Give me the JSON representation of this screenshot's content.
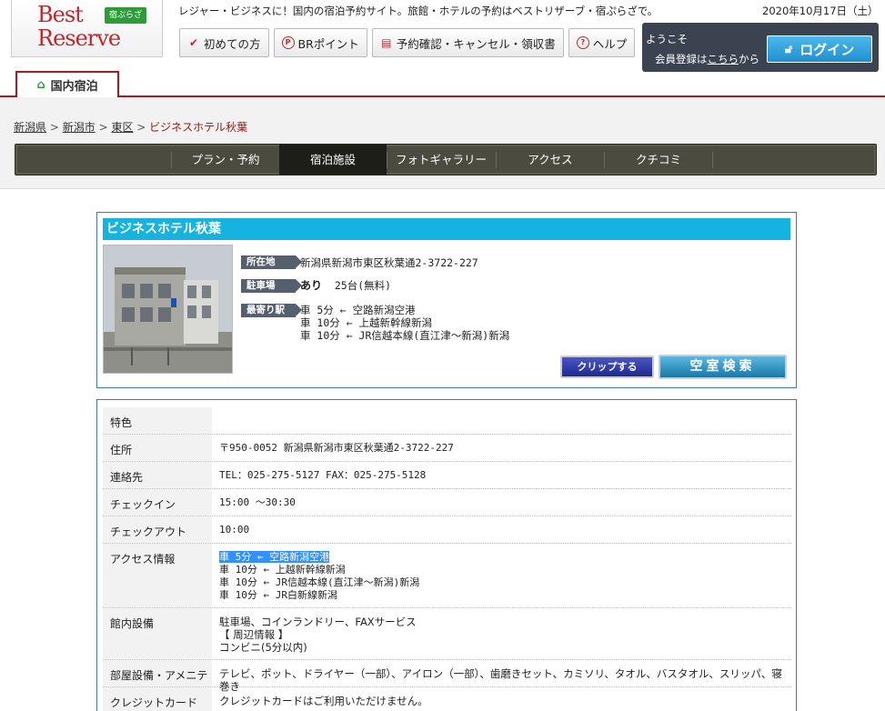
{
  "header": {
    "logo_best": "Best",
    "logo_reserve": "Reserve",
    "logo_badge": "宿ぷらざ",
    "tagline": "レジャー・ビジネスに！国内の宿泊予約サイト。旅館・ホテルの予約はベストリザーブ・宿ぷらざで。",
    "date": "2020年10月17日（土）",
    "nav": [
      {
        "label": "初めての方",
        "icon": "beginner-icon"
      },
      {
        "label": "BRポイント",
        "icon": "points-icon"
      },
      {
        "label": "予約確認・キャンセル・領収書",
        "icon": "document-icon"
      },
      {
        "label": "ヘルプ",
        "icon": "help-icon"
      }
    ],
    "welcome": "ようこそ",
    "register_prefix": "会員登録は",
    "register_link": "こちら",
    "register_suffix": "から",
    "login_label": "ログイン"
  },
  "tab": {
    "label": "国内宿泊"
  },
  "breadcrumb": [
    "新潟県",
    "新潟市",
    "東区",
    "ビジネスホテル秋葉"
  ],
  "subnav": [
    "プラン・予約",
    "宿泊施設",
    "フォトギャラリー",
    "アクセス",
    "クチコミ"
  ],
  "hotel": {
    "name": "ビジネスホテル秋葉",
    "address_label": "所在地",
    "address": "新潟県新潟市東区秋葉通2-3722-227",
    "parking_label": "駐車場",
    "parking_flag": "あり",
    "parking_detail": "25台(無料)",
    "station_label": "最寄り駅",
    "stations": [
      "車 5分 ← 空路新潟空港",
      "車 10分 ← 上越新幹線新潟",
      "車 10分 ← JR信越本線(直江津～新潟)新潟"
    ],
    "clip_label": "クリップする",
    "vacancy_label": "空室検索"
  },
  "details": [
    {
      "key": "特色",
      "value": ""
    },
    {
      "key": "住所",
      "value": "〒950-0052 新潟県新潟市東区秋葉通2-3722-227"
    },
    {
      "key": "連絡先",
      "value": "TEL：025-275-5127 FAX：025-275-5128"
    },
    {
      "key": "チェックイン",
      "value": "15:00 ～30:30"
    },
    {
      "key": "チェックアウト",
      "value": "10:00"
    },
    {
      "key": "アクセス情報",
      "lines": [
        "車 5分 ← 空路新潟空港",
        "車 10分 ← 上越新幹線新潟",
        "車 10分 ← JR信越本線(直江津～新潟)新潟",
        "車 10分 ← JR白新線新潟"
      ]
    },
    {
      "key": "館内設備",
      "lines": [
        "駐車場、コインランドリー、FAXサービス",
        "【 周辺情報 】",
        "コンビニ(5分以内)"
      ]
    },
    {
      "key": "部屋設備・アメニティ",
      "value": "テレビ、ポット、ドライヤー（一部）、アイロン（一部）、歯磨きセット、カミソリ、タオル、バスタオル、スリッパ、寝巻き"
    },
    {
      "key": "クレジットカード",
      "value": "クレジットカードはご利用いただけません。"
    }
  ],
  "colors": {
    "brand_red": "#c0272d",
    "accent_cyan": "#16b3e0",
    "nav_dark": "#4b4b40"
  }
}
